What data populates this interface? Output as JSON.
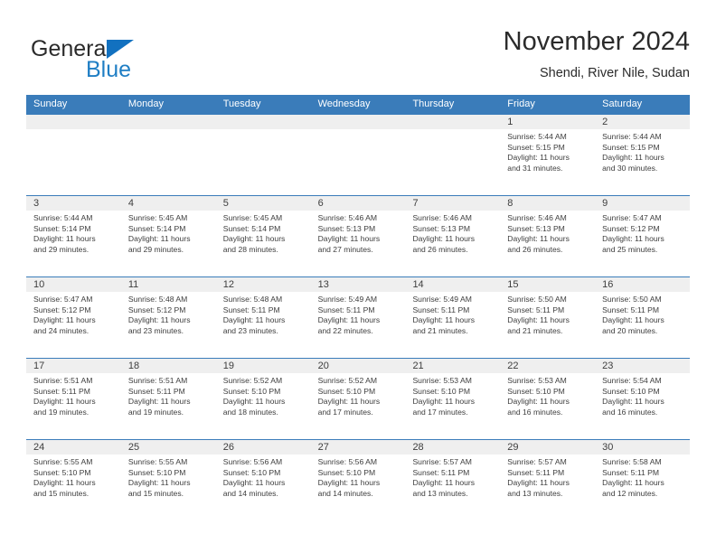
{
  "logo": {
    "word1": "General",
    "word2": "Blue",
    "triangle_color": "#1271c0",
    "blue_color": "#1f7ec4"
  },
  "header": {
    "title": "November 2024",
    "subtitle": "Shendi, River Nile, Sudan"
  },
  "theme": {
    "header_blue": "#3a7cba",
    "day_band_gray": "#efefef"
  },
  "weekdays": [
    "Sunday",
    "Monday",
    "Tuesday",
    "Wednesday",
    "Thursday",
    "Friday",
    "Saturday"
  ],
  "weeks": [
    [
      {
        "day": "",
        "empty": true
      },
      {
        "day": "",
        "empty": true
      },
      {
        "day": "",
        "empty": true
      },
      {
        "day": "",
        "empty": true
      },
      {
        "day": "",
        "empty": true
      },
      {
        "day": "1",
        "sunrise": "Sunrise: 5:44 AM",
        "sunset": "Sunset: 5:15 PM",
        "daylight1": "Daylight: 11 hours",
        "daylight2": "and 31 minutes."
      },
      {
        "day": "2",
        "sunrise": "Sunrise: 5:44 AM",
        "sunset": "Sunset: 5:15 PM",
        "daylight1": "Daylight: 11 hours",
        "daylight2": "and 30 minutes."
      }
    ],
    [
      {
        "day": "3",
        "sunrise": "Sunrise: 5:44 AM",
        "sunset": "Sunset: 5:14 PM",
        "daylight1": "Daylight: 11 hours",
        "daylight2": "and 29 minutes."
      },
      {
        "day": "4",
        "sunrise": "Sunrise: 5:45 AM",
        "sunset": "Sunset: 5:14 PM",
        "daylight1": "Daylight: 11 hours",
        "daylight2": "and 29 minutes."
      },
      {
        "day": "5",
        "sunrise": "Sunrise: 5:45 AM",
        "sunset": "Sunset: 5:14 PM",
        "daylight1": "Daylight: 11 hours",
        "daylight2": "and 28 minutes."
      },
      {
        "day": "6",
        "sunrise": "Sunrise: 5:46 AM",
        "sunset": "Sunset: 5:13 PM",
        "daylight1": "Daylight: 11 hours",
        "daylight2": "and 27 minutes."
      },
      {
        "day": "7",
        "sunrise": "Sunrise: 5:46 AM",
        "sunset": "Sunset: 5:13 PM",
        "daylight1": "Daylight: 11 hours",
        "daylight2": "and 26 minutes."
      },
      {
        "day": "8",
        "sunrise": "Sunrise: 5:46 AM",
        "sunset": "Sunset: 5:13 PM",
        "daylight1": "Daylight: 11 hours",
        "daylight2": "and 26 minutes."
      },
      {
        "day": "9",
        "sunrise": "Sunrise: 5:47 AM",
        "sunset": "Sunset: 5:12 PM",
        "daylight1": "Daylight: 11 hours",
        "daylight2": "and 25 minutes."
      }
    ],
    [
      {
        "day": "10",
        "sunrise": "Sunrise: 5:47 AM",
        "sunset": "Sunset: 5:12 PM",
        "daylight1": "Daylight: 11 hours",
        "daylight2": "and 24 minutes."
      },
      {
        "day": "11",
        "sunrise": "Sunrise: 5:48 AM",
        "sunset": "Sunset: 5:12 PM",
        "daylight1": "Daylight: 11 hours",
        "daylight2": "and 23 minutes."
      },
      {
        "day": "12",
        "sunrise": "Sunrise: 5:48 AM",
        "sunset": "Sunset: 5:11 PM",
        "daylight1": "Daylight: 11 hours",
        "daylight2": "and 23 minutes."
      },
      {
        "day": "13",
        "sunrise": "Sunrise: 5:49 AM",
        "sunset": "Sunset: 5:11 PM",
        "daylight1": "Daylight: 11 hours",
        "daylight2": "and 22 minutes."
      },
      {
        "day": "14",
        "sunrise": "Sunrise: 5:49 AM",
        "sunset": "Sunset: 5:11 PM",
        "daylight1": "Daylight: 11 hours",
        "daylight2": "and 21 minutes."
      },
      {
        "day": "15",
        "sunrise": "Sunrise: 5:50 AM",
        "sunset": "Sunset: 5:11 PM",
        "daylight1": "Daylight: 11 hours",
        "daylight2": "and 21 minutes."
      },
      {
        "day": "16",
        "sunrise": "Sunrise: 5:50 AM",
        "sunset": "Sunset: 5:11 PM",
        "daylight1": "Daylight: 11 hours",
        "daylight2": "and 20 minutes."
      }
    ],
    [
      {
        "day": "17",
        "sunrise": "Sunrise: 5:51 AM",
        "sunset": "Sunset: 5:11 PM",
        "daylight1": "Daylight: 11 hours",
        "daylight2": "and 19 minutes."
      },
      {
        "day": "18",
        "sunrise": "Sunrise: 5:51 AM",
        "sunset": "Sunset: 5:11 PM",
        "daylight1": "Daylight: 11 hours",
        "daylight2": "and 19 minutes."
      },
      {
        "day": "19",
        "sunrise": "Sunrise: 5:52 AM",
        "sunset": "Sunset: 5:10 PM",
        "daylight1": "Daylight: 11 hours",
        "daylight2": "and 18 minutes."
      },
      {
        "day": "20",
        "sunrise": "Sunrise: 5:52 AM",
        "sunset": "Sunset: 5:10 PM",
        "daylight1": "Daylight: 11 hours",
        "daylight2": "and 17 minutes."
      },
      {
        "day": "21",
        "sunrise": "Sunrise: 5:53 AM",
        "sunset": "Sunset: 5:10 PM",
        "daylight1": "Daylight: 11 hours",
        "daylight2": "and 17 minutes."
      },
      {
        "day": "22",
        "sunrise": "Sunrise: 5:53 AM",
        "sunset": "Sunset: 5:10 PM",
        "daylight1": "Daylight: 11 hours",
        "daylight2": "and 16 minutes."
      },
      {
        "day": "23",
        "sunrise": "Sunrise: 5:54 AM",
        "sunset": "Sunset: 5:10 PM",
        "daylight1": "Daylight: 11 hours",
        "daylight2": "and 16 minutes."
      }
    ],
    [
      {
        "day": "24",
        "sunrise": "Sunrise: 5:55 AM",
        "sunset": "Sunset: 5:10 PM",
        "daylight1": "Daylight: 11 hours",
        "daylight2": "and 15 minutes."
      },
      {
        "day": "25",
        "sunrise": "Sunrise: 5:55 AM",
        "sunset": "Sunset: 5:10 PM",
        "daylight1": "Daylight: 11 hours",
        "daylight2": "and 15 minutes."
      },
      {
        "day": "26",
        "sunrise": "Sunrise: 5:56 AM",
        "sunset": "Sunset: 5:10 PM",
        "daylight1": "Daylight: 11 hours",
        "daylight2": "and 14 minutes."
      },
      {
        "day": "27",
        "sunrise": "Sunrise: 5:56 AM",
        "sunset": "Sunset: 5:10 PM",
        "daylight1": "Daylight: 11 hours",
        "daylight2": "and 14 minutes."
      },
      {
        "day": "28",
        "sunrise": "Sunrise: 5:57 AM",
        "sunset": "Sunset: 5:11 PM",
        "daylight1": "Daylight: 11 hours",
        "daylight2": "and 13 minutes."
      },
      {
        "day": "29",
        "sunrise": "Sunrise: 5:57 AM",
        "sunset": "Sunset: 5:11 PM",
        "daylight1": "Daylight: 11 hours",
        "daylight2": "and 13 minutes."
      },
      {
        "day": "30",
        "sunrise": "Sunrise: 5:58 AM",
        "sunset": "Sunset: 5:11 PM",
        "daylight1": "Daylight: 11 hours",
        "daylight2": "and 12 minutes."
      }
    ]
  ]
}
